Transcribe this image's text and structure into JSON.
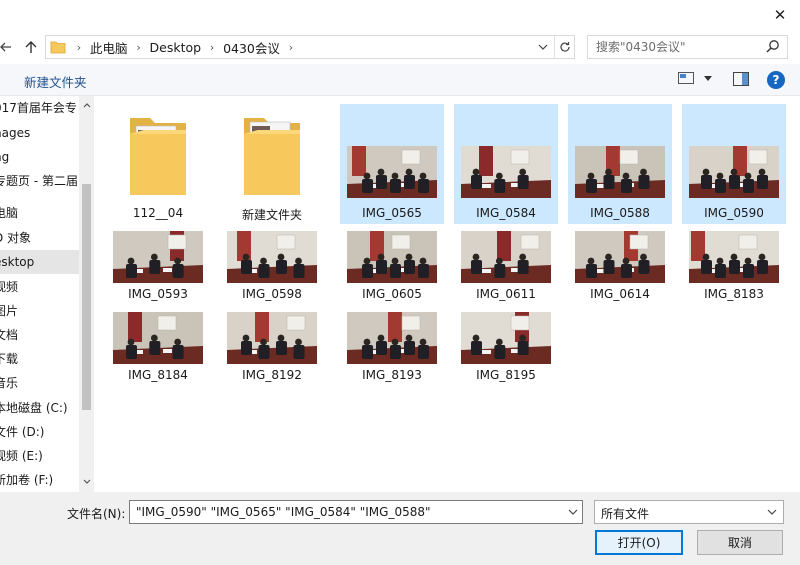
{
  "window": {
    "close_glyph": "✕"
  },
  "address": {
    "crumbs": [
      "此电脑",
      "Desktop",
      "0430会议"
    ],
    "search_placeholder": "搜索\"0430会议\""
  },
  "toolbar": {
    "new_folder_label": "新建文件夹",
    "help_glyph": "?"
  },
  "navpane": {
    "items": [
      "017首届年会专",
      "nages",
      "ng",
      "专题页 - 第二届",
      "电脑",
      "D 对象",
      "esktop",
      "视频",
      "图片",
      "文档",
      "下载",
      "音乐",
      "本地磁盘 (C:)",
      "文件 (D:)",
      "视频 (E:)",
      "新加卷 (F:)"
    ],
    "selected_index": 6
  },
  "files": [
    {
      "name": "112__04",
      "kind": "folder",
      "selected": false
    },
    {
      "name": "新建文件夹",
      "kind": "folder",
      "selected": false
    },
    {
      "name": "IMG_0565",
      "kind": "photo",
      "selected": true
    },
    {
      "name": "IMG_0584",
      "kind": "photo",
      "selected": true
    },
    {
      "name": "IMG_0588",
      "kind": "photo",
      "selected": true
    },
    {
      "name": "IMG_0590",
      "kind": "photo",
      "selected": true
    },
    {
      "name": "IMG_0593",
      "kind": "photo",
      "selected": false
    },
    {
      "name": "IMG_0598",
      "kind": "photo",
      "selected": false
    },
    {
      "name": "IMG_0605",
      "kind": "photo",
      "selected": false
    },
    {
      "name": "IMG_0611",
      "kind": "photo",
      "selected": false
    },
    {
      "name": "IMG_0614",
      "kind": "photo",
      "selected": false
    },
    {
      "name": "IMG_8183",
      "kind": "photo",
      "selected": false
    },
    {
      "name": "IMG_8184",
      "kind": "photo",
      "selected": false
    },
    {
      "name": "IMG_8192",
      "kind": "photo",
      "selected": false
    },
    {
      "name": "IMG_8193",
      "kind": "photo",
      "selected": false
    },
    {
      "name": "IMG_8195",
      "kind": "photo",
      "selected": false
    }
  ],
  "bottom": {
    "filename_label": "文件名(N):",
    "filename_value": "\"IMG_0590\" \"IMG_0565\" \"IMG_0584\" \"IMG_0588\"",
    "filetype_value": "所有文件",
    "open_label": "打开(O)",
    "cancel_label": "取消"
  },
  "colors": {
    "selection": "#cce8ff",
    "accent": "#0078d7",
    "link": "#1d4f91",
    "folder": "#f7c95c"
  },
  "icons": {
    "back": "arrow-left-icon",
    "up": "arrow-up-icon",
    "folder": "folder-icon",
    "refresh": "refresh-icon",
    "search": "search-icon",
    "view": "view-icon",
    "pane": "preview-pane-icon",
    "help": "help-icon"
  }
}
